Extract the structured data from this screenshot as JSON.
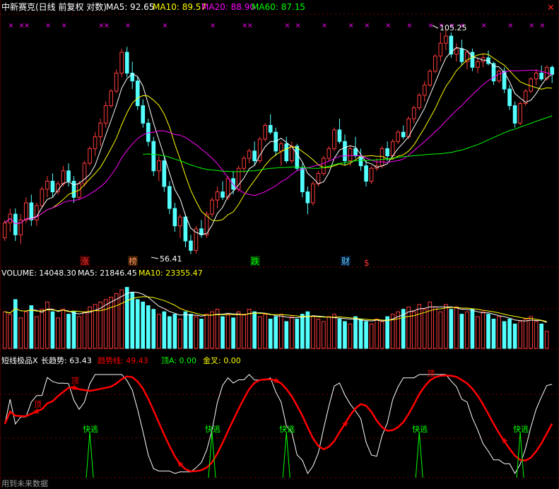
{
  "header": {
    "title": "中新赛克(日线 前复权 对数)",
    "ma5_label": "MA5: 92.65",
    "ma10_label": "MA10: 89.57",
    "ma20_label": "MA20: 88.90",
    "ma60_label": "MA60: 87.15",
    "close_glyph": "✕"
  },
  "price_panel": {
    "high_label": "105.25",
    "low_label": "56.41",
    "tags": [
      {
        "text": "涨",
        "color": "#ff3030"
      },
      {
        "text": "榜",
        "color": "#ff9966"
      },
      {
        "text": "跌",
        "color": "#00ff00"
      },
      {
        "text": "财",
        "color": "#66ccff"
      },
      {
        "text": "$",
        "color": "#ff3030"
      }
    ],
    "marker_glyph": "×"
  },
  "volume_panel": {
    "vol_label": "VOLUME: 14048.30",
    "ma5_label": "MA5: 21846.45",
    "ma10_label": "MA10: 23355.47"
  },
  "indicator_panel": {
    "name": "短线极品X",
    "long_trend": "长趋势: 63.43",
    "trend_line": "趋势线: 49.43",
    "top_a": "顶A: 0.00",
    "golden_cross": "金叉: 0.00",
    "top_label": "顶",
    "escape_label": "快逃",
    "footer": "用到未来数据"
  },
  "colors": {
    "up": "#ff3b3b",
    "down": "#54ffff",
    "ma5": "#ffffff",
    "ma10": "#ffff00",
    "ma20": "#ff00ff",
    "ma60": "#00ff00",
    "trend": "#ff0000",
    "grid": "#800000",
    "escape": "#00ff00"
  },
  "chart_data": {
    "type": "candlestick",
    "price_range": [
      56.41,
      105.25
    ],
    "candles": [
      [
        59.0,
        62.0,
        58.5,
        61.5
      ],
      [
        61.5,
        64.0,
        60.0,
        63.0
      ],
      [
        63.0,
        64.0,
        58.5,
        59.5
      ],
      [
        59.5,
        63.0,
        58.0,
        62.0
      ],
      [
        62.0,
        66.0,
        61.5,
        65.0
      ],
      [
        65.0,
        66.5,
        61.0,
        62.0
      ],
      [
        62.0,
        65.0,
        61.0,
        64.5
      ],
      [
        64.5,
        68.0,
        64.0,
        67.5
      ],
      [
        67.5,
        70.0,
        66.0,
        69.0
      ],
      [
        69.0,
        70.5,
        66.0,
        67.0
      ],
      [
        67.0,
        69.0,
        66.5,
        68.5
      ],
      [
        68.5,
        72.0,
        68.0,
        71.0
      ],
      [
        71.0,
        72.5,
        68.0,
        69.0
      ],
      [
        69.0,
        70.0,
        65.0,
        66.0
      ],
      [
        66.0,
        69.0,
        65.5,
        68.5
      ],
      [
        68.5,
        73.0,
        68.0,
        72.5
      ],
      [
        72.5,
        76.0,
        72.0,
        75.5
      ],
      [
        75.5,
        79.0,
        74.0,
        78.0
      ],
      [
        78.0,
        82.0,
        76.0,
        81.0
      ],
      [
        81.0,
        86.0,
        80.0,
        85.0
      ],
      [
        85.0,
        89.0,
        84.5,
        88.5
      ],
      [
        88.5,
        94.0,
        88.0,
        93.0
      ],
      [
        93.0,
        99.5,
        92.0,
        98.5
      ],
      [
        98.5,
        100.0,
        92.0,
        93.0
      ],
      [
        93.0,
        96.0,
        89.0,
        91.0
      ],
      [
        91.0,
        92.0,
        84.0,
        85.0
      ],
      [
        85.0,
        86.5,
        80.0,
        81.0
      ],
      [
        81.0,
        82.0,
        76.0,
        77.0
      ],
      [
        77.0,
        78.0,
        70.0,
        71.0
      ],
      [
        71.0,
        74.0,
        69.0,
        73.0
      ],
      [
        73.0,
        74.0,
        67.0,
        68.0
      ],
      [
        68.0,
        69.0,
        63.0,
        64.0
      ],
      [
        64.0,
        65.0,
        60.0,
        61.0
      ],
      [
        61.0,
        63.0,
        59.0,
        62.5
      ],
      [
        62.5,
        63.0,
        57.5,
        58.5
      ],
      [
        58.5,
        59.5,
        56.41,
        57.0
      ],
      [
        57.0,
        61.0,
        56.5,
        60.5
      ],
      [
        60.5,
        62.0,
        59.0,
        59.5
      ],
      [
        59.5,
        63.5,
        59.0,
        63.0
      ],
      [
        63.0,
        66.0,
        62.5,
        65.5
      ],
      [
        65.5,
        68.0,
        64.0,
        67.0
      ],
      [
        67.0,
        69.0,
        65.5,
        66.0
      ],
      [
        66.0,
        70.0,
        65.5,
        69.5
      ],
      [
        69.5,
        71.0,
        66.5,
        67.5
      ],
      [
        67.5,
        72.0,
        67.0,
        71.5
      ],
      [
        71.5,
        74.0,
        70.5,
        73.5
      ],
      [
        73.5,
        75.5,
        72.5,
        75.0
      ],
      [
        75.0,
        77.0,
        72.0,
        73.0
      ],
      [
        73.0,
        78.0,
        72.5,
        77.5
      ],
      [
        77.5,
        81.0,
        77.0,
        80.5
      ],
      [
        80.5,
        83.0,
        78.5,
        79.0
      ],
      [
        79.0,
        80.0,
        74.0,
        75.0
      ],
      [
        75.0,
        77.0,
        72.0,
        76.5
      ],
      [
        76.5,
        78.0,
        72.5,
        73.0
      ],
      [
        73.0,
        77.0,
        72.5,
        76.0
      ],
      [
        76.0,
        76.5,
        71.0,
        71.5
      ],
      [
        71.5,
        72.5,
        66.0,
        67.0
      ],
      [
        67.0,
        68.0,
        63.0,
        65.0
      ],
      [
        65.0,
        69.0,
        64.5,
        68.5
      ],
      [
        68.5,
        71.0,
        68.0,
        70.5
      ],
      [
        70.5,
        74.0,
        70.0,
        73.5
      ],
      [
        73.5,
        76.0,
        73.0,
        75.5
      ],
      [
        75.5,
        80.0,
        75.0,
        79.5
      ],
      [
        79.5,
        82.0,
        76.5,
        77.0
      ],
      [
        77.0,
        78.5,
        72.0,
        73.0
      ],
      [
        73.0,
        76.0,
        72.0,
        75.5
      ],
      [
        75.5,
        78.0,
        73.5,
        74.0
      ],
      [
        74.0,
        75.5,
        71.0,
        72.0
      ],
      [
        72.0,
        73.0,
        68.0,
        69.0
      ],
      [
        69.0,
        72.0,
        68.5,
        71.5
      ],
      [
        71.5,
        73.5,
        71.0,
        72.0
      ],
      [
        72.0,
        76.0,
        71.5,
        75.5
      ],
      [
        75.5,
        77.0,
        73.0,
        74.0
      ],
      [
        74.0,
        77.5,
        73.5,
        77.0
      ],
      [
        77.0,
        79.5,
        76.5,
        79.0
      ],
      [
        79.0,
        80.5,
        77.5,
        78.0
      ],
      [
        78.0,
        82.5,
        77.5,
        82.0
      ],
      [
        82.0,
        85.0,
        81.0,
        84.5
      ],
      [
        84.5,
        88.0,
        84.0,
        87.5
      ],
      [
        87.5,
        91.0,
        86.0,
        90.0
      ],
      [
        90.0,
        94.0,
        89.5,
        93.5
      ],
      [
        93.5,
        98.0,
        93.0,
        97.5
      ],
      [
        97.5,
        104.0,
        96.0,
        101.0
      ],
      [
        101.0,
        105.25,
        99.0,
        103.0
      ],
      [
        103.0,
        104.0,
        97.0,
        98.0
      ],
      [
        98.0,
        101.0,
        96.0,
        99.5
      ],
      [
        99.5,
        102.0,
        95.0,
        96.0
      ],
      [
        96.0,
        99.0,
        94.0,
        98.5
      ],
      [
        98.5,
        99.5,
        93.5,
        94.5
      ],
      [
        94.5,
        97.0,
        93.0,
        96.0
      ],
      [
        96.0,
        98.0,
        94.5,
        97.0
      ],
      [
        97.0,
        99.0,
        95.0,
        95.5
      ],
      [
        95.5,
        96.0,
        90.0,
        91.0
      ],
      [
        91.0,
        94.0,
        90.5,
        93.5
      ],
      [
        93.5,
        94.5,
        88.0,
        89.0
      ],
      [
        89.0,
        90.0,
        84.0,
        85.0
      ],
      [
        85.0,
        86.0,
        80.0,
        81.0
      ],
      [
        81.0,
        86.0,
        80.5,
        85.5
      ],
      [
        85.5,
        89.0,
        85.0,
        88.5
      ],
      [
        88.5,
        92.0,
        88.0,
        91.5
      ],
      [
        91.5,
        94.0,
        90.0,
        93.0
      ],
      [
        93.0,
        95.0,
        91.0,
        91.5
      ],
      [
        91.5,
        95.0,
        91.0,
        94.5
      ],
      [
        94.5,
        95.0,
        90.5,
        92.65
      ]
    ],
    "volume": [
      30,
      28,
      40,
      25,
      30,
      35,
      26,
      32,
      38,
      30,
      25,
      32,
      28,
      30,
      26,
      30,
      34,
      36,
      38,
      40,
      42,
      45,
      48,
      50,
      46,
      40,
      38,
      35,
      32,
      28,
      30,
      26,
      28,
      24,
      30,
      28,
      26,
      24,
      28,
      30,
      32,
      26,
      28,
      25,
      30,
      28,
      32,
      30,
      26,
      28,
      24,
      26,
      28,
      22,
      26,
      24,
      28,
      30,
      26,
      24,
      22,
      26,
      28,
      24,
      22,
      20,
      26,
      24,
      22,
      20,
      24,
      22,
      26,
      28,
      30,
      32,
      34,
      30,
      36,
      32,
      38,
      34,
      30,
      36,
      32,
      34,
      28,
      30,
      32,
      26,
      30,
      28,
      24,
      26,
      22,
      24,
      20,
      22,
      24,
      26,
      22,
      20,
      14
    ],
    "indicator": {
      "long_trend_last": 63.43,
      "trend_line_last": 49.43,
      "top_a": 0.0,
      "golden_cross": 0.0
    }
  }
}
